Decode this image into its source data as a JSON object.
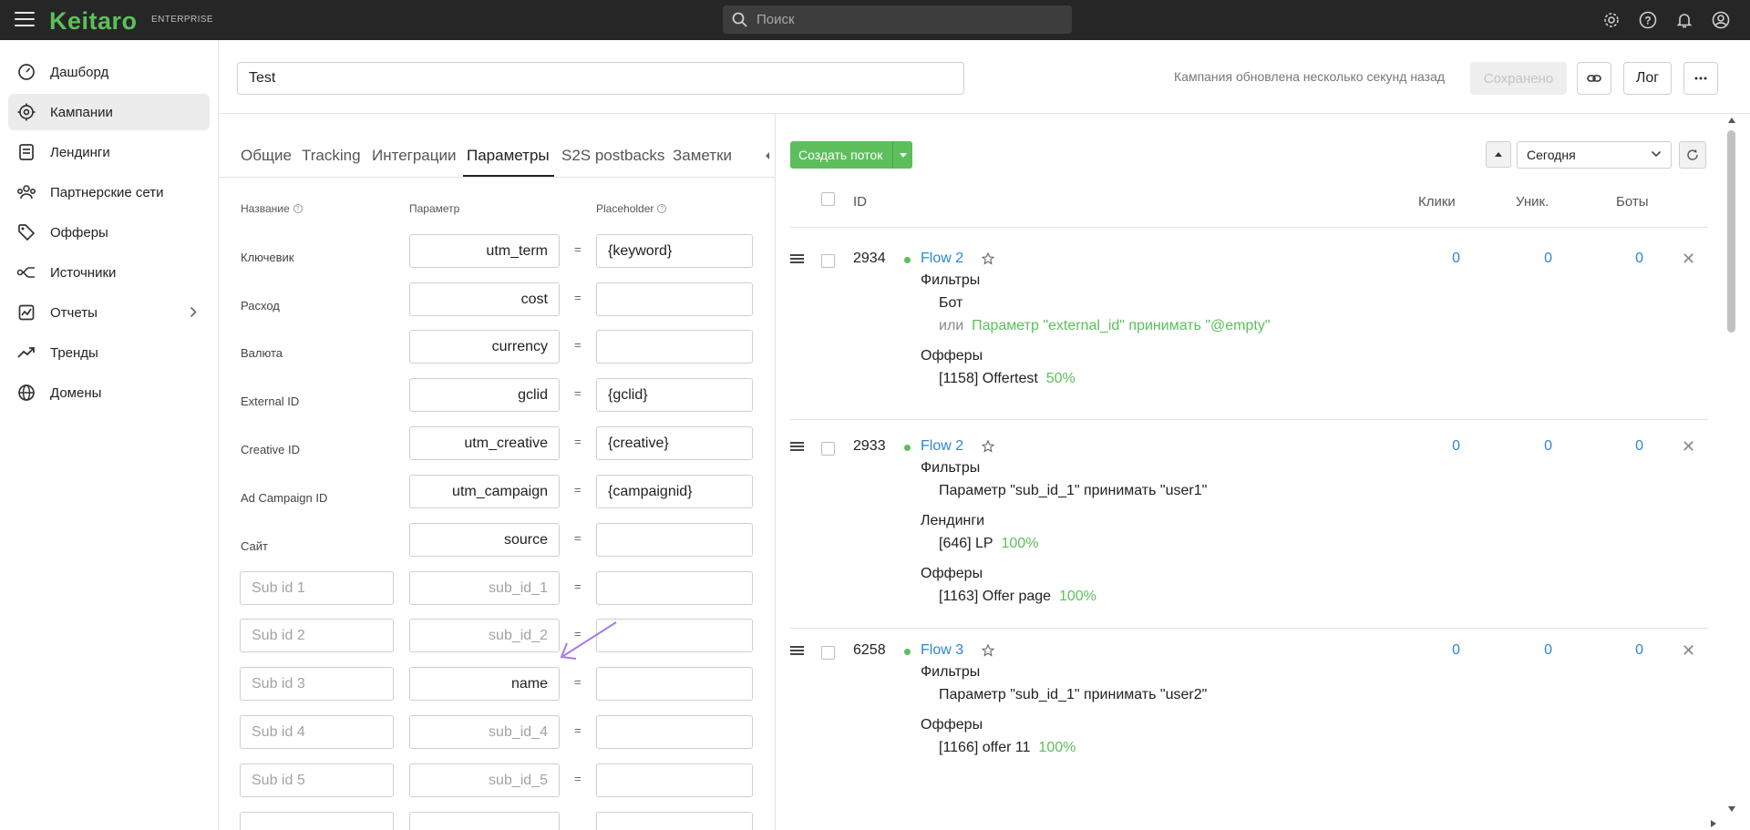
{
  "brand": {
    "name": "Keitaro",
    "edition": "ENTERPRISE",
    "accent": "#5cbf5b"
  },
  "search": {
    "placeholder": "Поиск"
  },
  "sidebar": {
    "items": [
      {
        "label": "Дашборд",
        "icon": "dashboard-icon"
      },
      {
        "label": "Кампании",
        "icon": "target-icon",
        "active": true
      },
      {
        "label": "Лендинги",
        "icon": "landing-icon"
      },
      {
        "label": "Партнерские сети",
        "icon": "network-icon"
      },
      {
        "label": "Офферы",
        "icon": "tag-icon"
      },
      {
        "label": "Источники",
        "icon": "source-icon"
      },
      {
        "label": "Отчеты",
        "icon": "report-icon",
        "has_submenu": true
      },
      {
        "label": "Тренды",
        "icon": "trend-icon"
      },
      {
        "label": "Домены",
        "icon": "globe-icon"
      }
    ]
  },
  "campaign": {
    "name": "Test",
    "updated_text": "Кампания обновлена несколько секунд назад",
    "saved_label": "Сохранено",
    "log_label": "Лог"
  },
  "tabs": [
    "Общие",
    "Tracking",
    "Интеграции",
    "Параметры",
    "S2S postbacks",
    "Заметки"
  ],
  "active_tab": "Параметры",
  "params": {
    "headers": {
      "name": "Название",
      "param": "Параметр",
      "placeholder": "Placeholder"
    },
    "rows": [
      {
        "label": "Ключевик",
        "param": "utm_term",
        "placeholder": "{keyword}"
      },
      {
        "label": "Расход",
        "param": "cost",
        "placeholder": ""
      },
      {
        "label": "Валюта",
        "param": "currency",
        "placeholder": ""
      },
      {
        "label": "External ID",
        "param": "gclid",
        "placeholder": "{gclid}"
      },
      {
        "label": "Creative ID",
        "param": "utm_creative",
        "placeholder": "{creative}"
      },
      {
        "label": "Ad Campaign ID",
        "param": "utm_campaign",
        "placeholder": "{campaignid}"
      },
      {
        "label": "Сайт",
        "param": "source",
        "placeholder": ""
      }
    ],
    "sub_rows": [
      {
        "name_placeholder": "Sub id 1",
        "param": "sub_id_1",
        "dim": true
      },
      {
        "name_placeholder": "Sub id 2",
        "param": "sub_id_2",
        "dim": true
      },
      {
        "name_placeholder": "Sub id 3",
        "param": "name",
        "dim": false
      },
      {
        "name_placeholder": "Sub id 4",
        "param": "sub_id_4",
        "dim": true
      },
      {
        "name_placeholder": "Sub id 5",
        "param": "sub_id_5",
        "dim": true
      }
    ],
    "eq": "="
  },
  "flows_toolbar": {
    "create_label": "Создать поток",
    "date_range": "Сегодня"
  },
  "flows_table": {
    "headers": {
      "id": "ID",
      "clicks": "Клики",
      "unique": "Уник.",
      "bots": "Боты"
    },
    "flows": [
      {
        "id": "2934",
        "name": "Flow 2",
        "clicks": "0",
        "unique": "0",
        "bots": "0",
        "filters_title": "Фильтры",
        "filter_lines": [
          "Бот"
        ],
        "filter_or": "или",
        "filter_or_text": "Параметр \"external_id\"  принимать \"@empty\"",
        "offers_title": "Офферы",
        "offer_name": "[1158] Offertest",
        "offer_share": "50%"
      },
      {
        "id": "2933",
        "name": "Flow 2",
        "clicks": "0",
        "unique": "0",
        "bots": "0",
        "filters_title": "Фильтры",
        "filter_text": "Параметр \"sub_id_1\"  принимать \"user1\"",
        "landings_title": "Лендинги",
        "landing_name": "[646] LP",
        "landing_share": "100%",
        "offers_title": "Офферы",
        "offer_name": "[1163] Offer page",
        "offer_share": "100%"
      },
      {
        "id": "6258",
        "name": "Flow 3",
        "clicks": "0",
        "unique": "0",
        "bots": "0",
        "filters_title": "Фильтры",
        "filter_text": "Параметр \"sub_id_1\"  принимать \"user2\"",
        "offers_title": "Офферы",
        "offer_name": "[1166] offer 11",
        "offer_share": "100%"
      }
    ]
  },
  "annotation": {
    "arrow_color": "#a77ae6"
  }
}
